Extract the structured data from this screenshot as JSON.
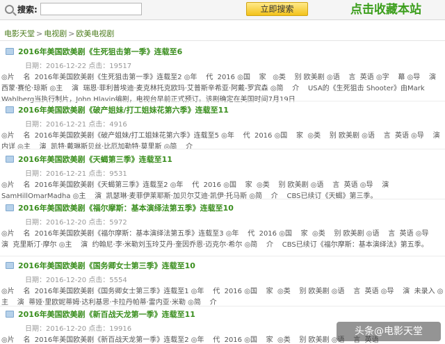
{
  "topbar": {
    "search_label": "搜索:",
    "search_value": "",
    "search_button": "立即搜索",
    "bookmark_label": "点击收藏本站"
  },
  "breadcrumb": [
    "电影天堂",
    "电视剧",
    "欧美电视剧"
  ],
  "breadcrumb_sep": ">",
  "entries": [
    {
      "title": "2016年美国欧美剧《生死狙击第一季》连载至6",
      "meta": "日期：2016-12-22  点击：19517",
      "body": "◎片    名  2016年美国欧美剧《生死狙击第一季》连载至2 ◎年    代  2016 ◎国    家   ◎类    别 欧美剧 ◎语    言  英语 ◎字    幕 ◎导    演  西蒙·赛伦·琼斯 ◎主    演  瑞恩·菲利普埃迪·麦克林托克欧玛·艾普斯辛希亚·阿戴-罗宾森 ◎简    介    USA的《生死狙击 Shooter》由Mark Wahlberg当执行制片，John Hlavin编剧，电视台早前正式预订。该剧确定在美国时间7月19日"
    },
    {
      "title": "2016年美国欧美剧《破产姐妹/打工姐妹花第六季》连载至11",
      "meta": "日期：2016-12-21  点击：4916",
      "body": "◎片    名  2016年美国欧美剧《破产姐妹/打工姐妹花第六季》连载至5 ◎年    代  2016 ◎国    家  ◎类    别 欧美剧 ◎语    言  英语 ◎导    演  内详 ◎主    演  凯特·戴琳斯贝丝·比厄加勒特·莫里斯 ◎简    介"
    },
    {
      "title": "2016年美国欧美剧《天蝎第三季》连载至11",
      "meta": "日期：2016-12-21  点击：9531",
      "body": "◎片    名  2016年美国欧美剧《天蝎第三季》连载至2 ◎年    代  2016 ◎国    家  ◎类    别 欧美剧 ◎语    言  英语 ◎导    演  SamHillOmarMadha ◎主    演  凯瑟琳·麦菲伊莱耶斯·加贝尔艾迪·凯伊·托马斯 ◎简    介    CBS已续订《天蝎》第三季。"
    },
    {
      "title": "2016年美国欧美剧《福尔摩斯：基本演绎法第五季》连载至10",
      "meta": "日期：2016-12-20  点击：5972",
      "body": "◎片    名  2016年美国欧美剧《福尔摩斯：基本演绎法第五季》连载至3 ◎年    代  2016 ◎国    家  ◎类    别 欧美剧 ◎语    言  英语 ◎导    演  克里斯汀·摩尔 ◎主    演  约翰尼·李·米勒刘玉玲艾丹·奎因乔恩·迈克尔·希尔 ◎简    介    CBS已续订《福尔摩斯：基本演绎法》第五季。"
    },
    {
      "title": "2016年美国欧美剧《国务卿女士第三季》连载至10",
      "meta": "日期：2016-12-20  点击：5554",
      "body": "◎片    名  2016年美国欧美剧《国务卿女士第三季》连载至1 ◎年    代  2016 ◎国    家  ◎类    别 欧美剧 ◎语    言  英语 ◎导    演  未录入 ◎主    演  蒂娅·里欧妮蒂姆·达利基思·卡拉丹帕蒂·雷内亚·米勒 ◎简    介"
    },
    {
      "title": "2016年美国欧美剧《新百战天龙第一季》连载至11",
      "meta": "日期：2016-12-20  点击：19916",
      "body": "◎片    名  2016年美国欧美剧《新百战天龙第一季》连载至2 ◎年    代  2016 ◎国    家  ◎类    别 欧美剧 ◎语    言  英语"
    }
  ],
  "watermark": "头条@电影天堂"
}
